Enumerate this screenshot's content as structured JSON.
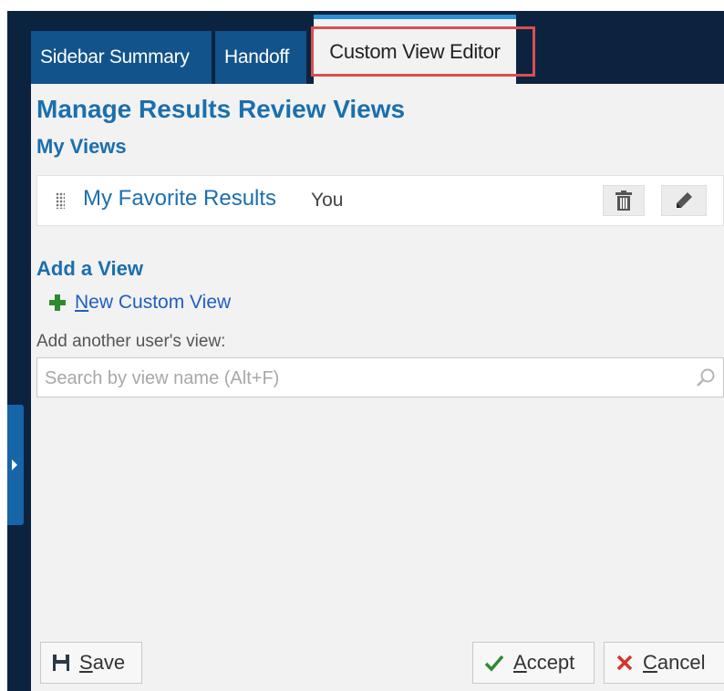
{
  "tabs": [
    {
      "label": "Sidebar Summary"
    },
    {
      "label": "Handoff"
    },
    {
      "label": "Custom View Editor",
      "active": true
    }
  ],
  "page_title": "Manage Results Review Views",
  "my_views": {
    "heading": "My Views",
    "items": [
      {
        "name": "My Favorite Results",
        "owner": "You"
      }
    ]
  },
  "add_view": {
    "heading": "Add a View",
    "new_custom_view_label": "New Custom View",
    "another_users_label": "Add another user's view:",
    "search_placeholder": "Search by view name (Alt+F)"
  },
  "footer": {
    "save_label": "Save",
    "accept_label": "Accept",
    "cancel_label": "Cancel"
  },
  "colors": {
    "frame": "#0c2340",
    "tab": "#12538c",
    "heading": "#1b6fad",
    "link": "#1f5fc1",
    "accept_check": "#2f8a2f",
    "cancel_x": "#d8342b",
    "highlight_box": "#d94f4f"
  },
  "icons": [
    "drag-handle-icon",
    "trash-icon",
    "pencil-icon",
    "plus-icon",
    "search-icon",
    "save-disk-icon",
    "check-icon",
    "close-x-icon",
    "expand-arrow-icon"
  ]
}
